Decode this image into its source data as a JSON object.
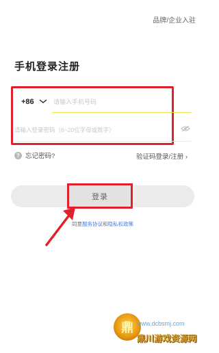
{
  "header": {
    "brand_enterprise_link": "品牌/企业入驻"
  },
  "page": {
    "title": "手机登录注册"
  },
  "form": {
    "country_code": "+86",
    "phone_placeholder": "请输入手机号码",
    "password_placeholder": "请输入登录密码（6~20位字母或数字）",
    "forgot_password": "忘记密码?",
    "alt_login": "验证码登录/注册 ›",
    "login_button": "登录"
  },
  "agreement": {
    "prefix": "同意",
    "service_link": "服务协议",
    "connector": "和",
    "privacy_link": "隐私权政策"
  },
  "watermark": {
    "url": "www.dcbsmj.com",
    "title": "鼎川游戏资源网"
  },
  "colors": {
    "highlight": "#e0202a",
    "accent_underline": "#f0e24a",
    "link": "#4a7bd6"
  }
}
